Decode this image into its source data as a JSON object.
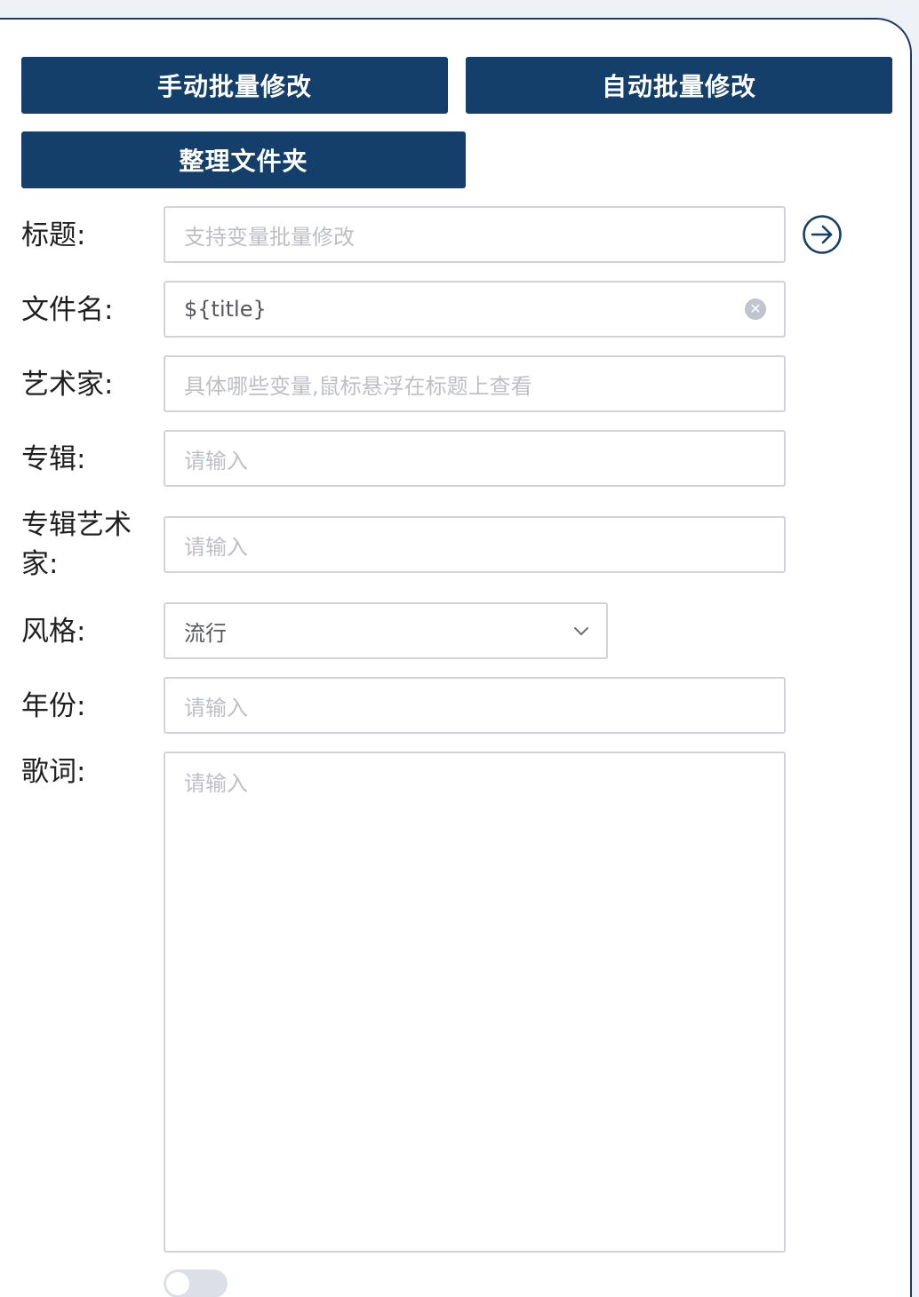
{
  "toolbar": {
    "manual_batch_label": "手动批量修改",
    "auto_batch_label": "自动批量修改",
    "organize_folder_label": "整理文件夹"
  },
  "form": {
    "title": {
      "label": "标题:",
      "placeholder": "支持变量批量修改"
    },
    "filename": {
      "label": "文件名:",
      "value": "${title}"
    },
    "artist": {
      "label": "艺术家:",
      "placeholder": "具体哪些变量,鼠标悬浮在标题上查看"
    },
    "album": {
      "label": "专辑:",
      "placeholder": "请输入"
    },
    "album_artist": {
      "label_line1": "专辑艺术",
      "label_line2": "家:",
      "placeholder": "请输入"
    },
    "genre": {
      "label": "风格:",
      "value": "流行"
    },
    "year": {
      "label": "年份:",
      "placeholder": "请输入"
    },
    "lyrics": {
      "label": "歌词:",
      "placeholder": "请输入"
    }
  },
  "icons": {
    "go": "arrow-right-circle-icon",
    "clear": "clear-circle-icon",
    "dropdown": "chevron-down-icon"
  },
  "colors": {
    "primary": "#143f6b",
    "border": "#d0d4da",
    "placeholder": "#bdbfc4"
  }
}
